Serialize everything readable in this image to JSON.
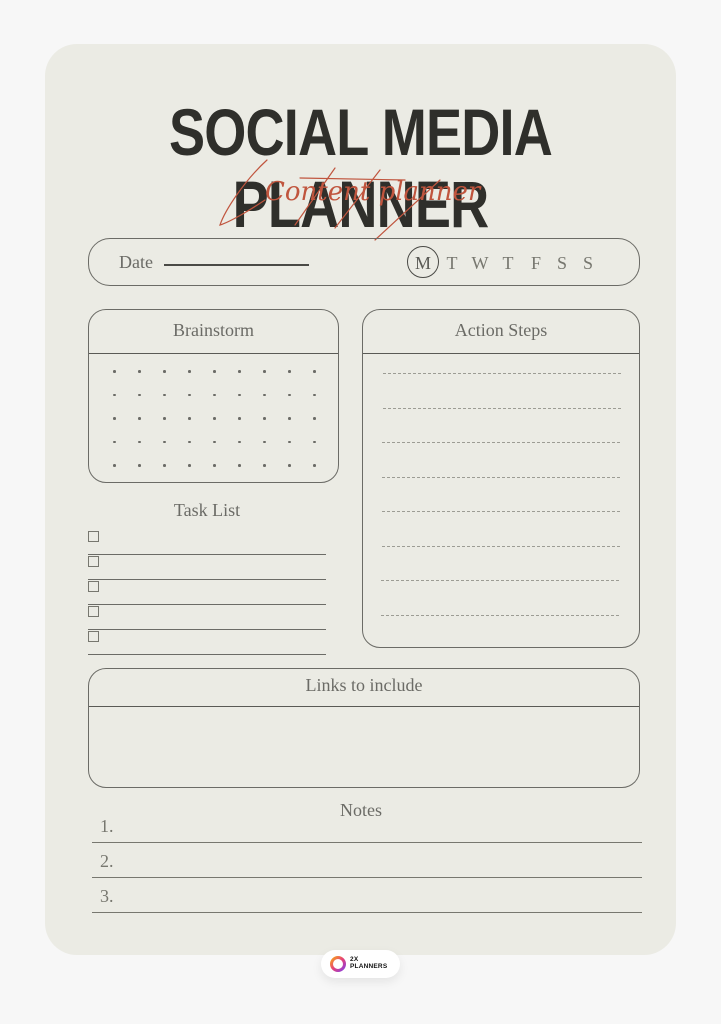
{
  "page": {
    "title": "SOCIAL MEDIA PLANNER",
    "subtitle": "Content planner",
    "colors": {
      "background": "#f7f7f7",
      "card": "#ebebe4",
      "title": "#2f2f2b",
      "accent_script": "#c0553e",
      "line": "#6b6b66"
    }
  },
  "date_bar": {
    "label": "Date",
    "days": [
      {
        "label": "M",
        "selected": true
      },
      {
        "label": "T",
        "selected": false
      },
      {
        "label": "W",
        "selected": false
      },
      {
        "label": "T",
        "selected": false
      },
      {
        "label": "F",
        "selected": false
      },
      {
        "label": "S",
        "selected": false
      },
      {
        "label": "S",
        "selected": false
      }
    ]
  },
  "brainstorm": {
    "title": "Brainstorm",
    "dot_grid": {
      "columns": 9,
      "rows": 5
    }
  },
  "action_steps": {
    "title": "Action Steps",
    "line_count": 8
  },
  "task_list": {
    "title": "Task List",
    "items": [
      "",
      "",
      "",
      "",
      ""
    ]
  },
  "links": {
    "title": "Links to include"
  },
  "notes": {
    "title": "Notes",
    "items": [
      {
        "number": "1."
      },
      {
        "number": "2."
      },
      {
        "number": "3."
      }
    ]
  },
  "badge": {
    "line1": "2X",
    "line2": "PLANNERS",
    "logo_icon": "ring-logo-icon"
  }
}
